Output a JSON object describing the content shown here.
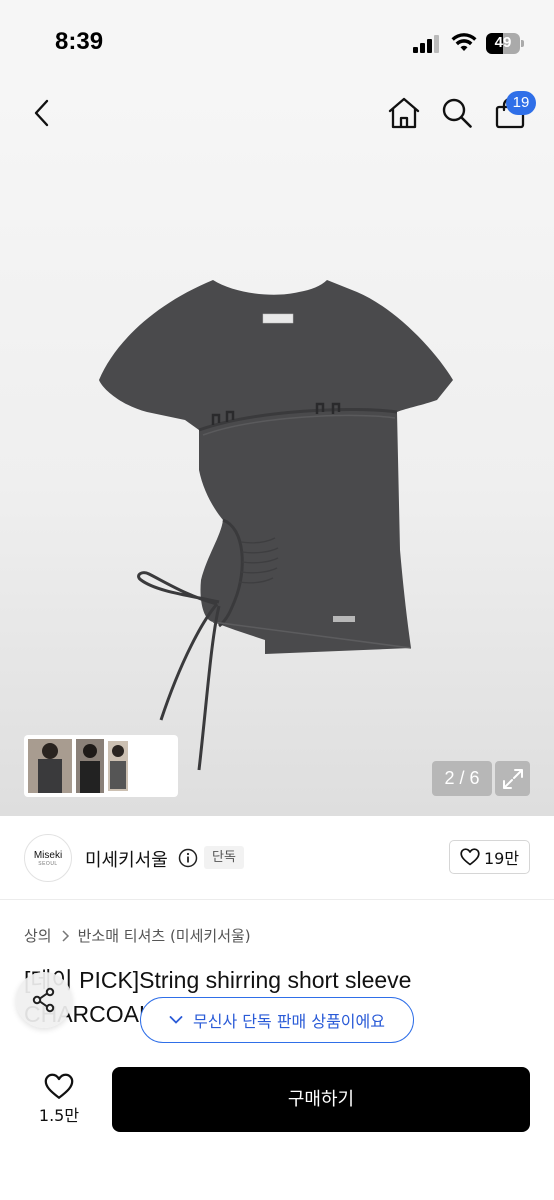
{
  "status_bar": {
    "time": "8:39",
    "battery_level": "49",
    "battery_fraction": 0.49
  },
  "header": {
    "icons": [
      "back-icon",
      "home-icon",
      "search-icon",
      "cart-icon"
    ],
    "cart_badge": "19"
  },
  "gallery": {
    "counter": "2 / 6",
    "current": 2,
    "total": 6,
    "product_color": "#4a4a4c"
  },
  "brand": {
    "logo_text": "Miseki",
    "logo_sub": "SEOUL",
    "name": "미세키서울",
    "badge": "단독",
    "like_count": "19만"
  },
  "breadcrumb": [
    "상의",
    "반소매 티셔츠 (미세키서울)"
  ],
  "product": {
    "title": "[데이 PICK]String shirring short sleeve CHARCOAL"
  },
  "exclusive_pill": {
    "text": "무신사 단독 판매 상품이에요",
    "color": "#2f6fe8"
  },
  "bottom_bar": {
    "like_count": "1.5만",
    "buy_label": "구매하기"
  }
}
